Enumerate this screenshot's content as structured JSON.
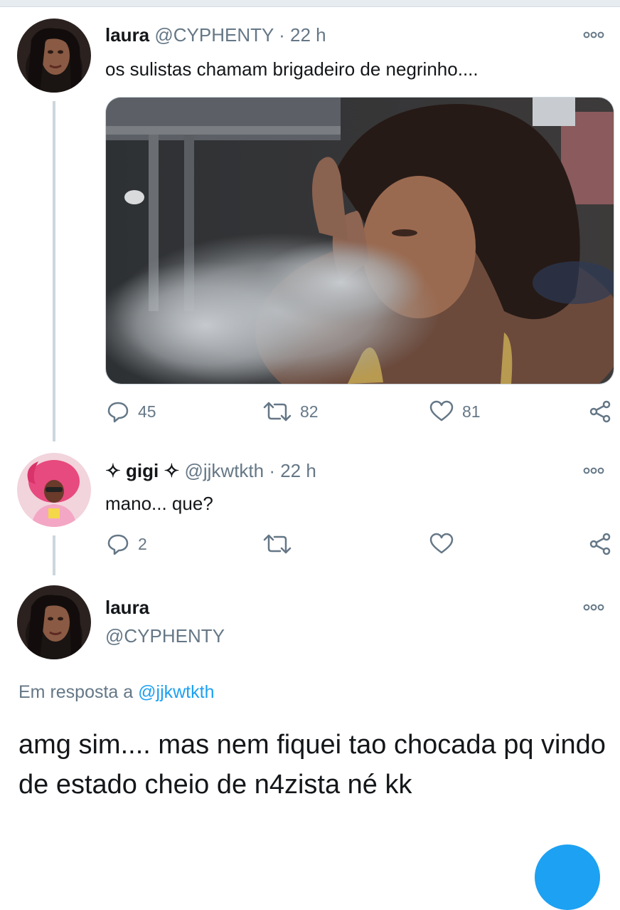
{
  "tweet1": {
    "display_name": "laura",
    "handle": "@CYPHENTY",
    "time": "· 22 h",
    "text": "os sulistas chamam brigadeiro de negrinho....",
    "media_icon": "photo",
    "replies": "45",
    "retweets": "82",
    "likes": "81"
  },
  "tweet2": {
    "display_name": "✧ gigi ✧",
    "handle": "@jjkwtkth",
    "time": "· 22 h",
    "text": "mano... que?",
    "replies": "2",
    "retweets": "",
    "likes": ""
  },
  "tweet3": {
    "display_name": "laura",
    "handle": "@CYPHENTY",
    "reply_prefix": "Em resposta a ",
    "reply_handle": "@jjkwtkth",
    "text": "amg sim.... mas nem fiquei tao chocada pq vindo de estado cheio de n4zista né kk"
  },
  "icons": {
    "more": "more-options-icon",
    "reply": "reply-icon",
    "retweet": "retweet-icon",
    "like": "heart-icon",
    "share": "share-icon",
    "compose": "compose-fab"
  },
  "colors": {
    "accent": "#1da1f2",
    "muted": "#657786",
    "thread_line": "#ccd6dd"
  }
}
